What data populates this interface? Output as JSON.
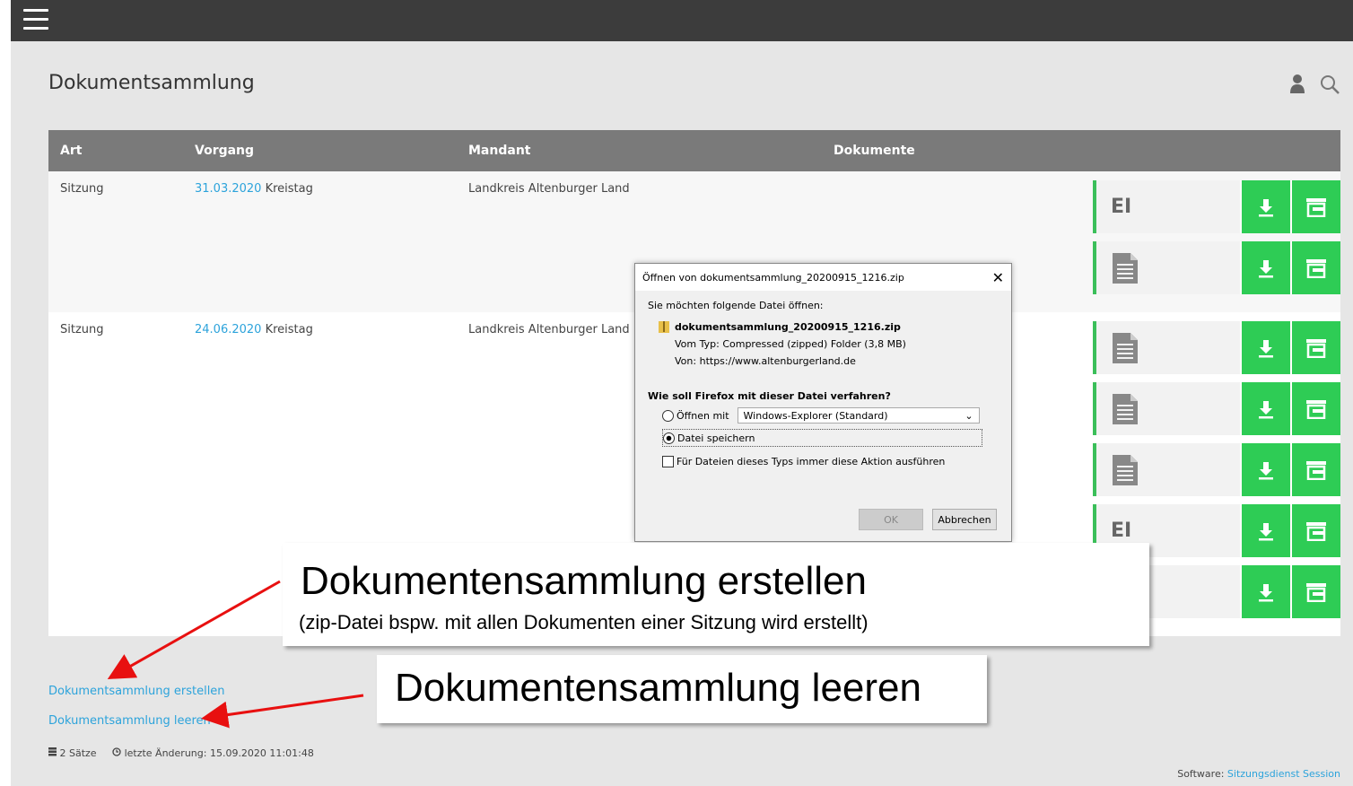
{
  "page": {
    "title": "Dokumentsammlung"
  },
  "table": {
    "headers": {
      "art": "Art",
      "vorgang": "Vorgang",
      "mandant": "Mandant",
      "dokumente": "Dokumente"
    },
    "rows": [
      {
        "art": "Sitzung",
        "date": "31.03.2020",
        "name": "Kreistag",
        "mandant": "Landkreis Altenburger Land"
      },
      {
        "art": "Sitzung",
        "date": "24.06.2020",
        "name": "Kreistag",
        "mandant": "Landkreis Altenburger Land"
      }
    ],
    "doc_label_ei": "EI"
  },
  "links": {
    "create": "Dokumentsammlung erstellen",
    "clear": "Dokumentsammlung leeren"
  },
  "footer": {
    "records": "2 Sätze",
    "last_change": "letzte Änderung: 15.09.2020 11:01:48",
    "software_label": "Software:",
    "software_link": "Sitzungsdienst Session"
  },
  "dialog": {
    "title": "Öffnen von dokumentsammlung_20200915_1216.zip",
    "intro": "Sie möchten folgende Datei öffnen:",
    "filename": "dokumentsammlung_20200915_1216.zip",
    "type_label": "Vom Typ:",
    "type_value": "Compressed (zipped) Folder (3,8 MB)",
    "from_label": "Von:",
    "from_value": "https://www.altenburgerland.de",
    "question": "Wie soll Firefox mit dieser Datei verfahren?",
    "open_with": "Öffnen mit",
    "open_with_app": "Windows-Explorer (Standard)",
    "save_file": "Datei speichern",
    "always": "Für Dateien dieses Typs immer diese Aktion ausführen",
    "ok": "OK",
    "cancel": "Abbrechen"
  },
  "callouts": {
    "create_title": "Dokumentensammlung erstellen",
    "create_sub": "(zip-Datei bspw. mit allen Dokumenten einer Sitzung wird erstellt)",
    "clear_title": "Dokumentensammlung leeren"
  },
  "colors": {
    "accent": "#2ecc55",
    "link": "#2ca3db",
    "topbar": "#3c3c3c",
    "header": "#7a7a7a",
    "arrow": "#e81010"
  }
}
